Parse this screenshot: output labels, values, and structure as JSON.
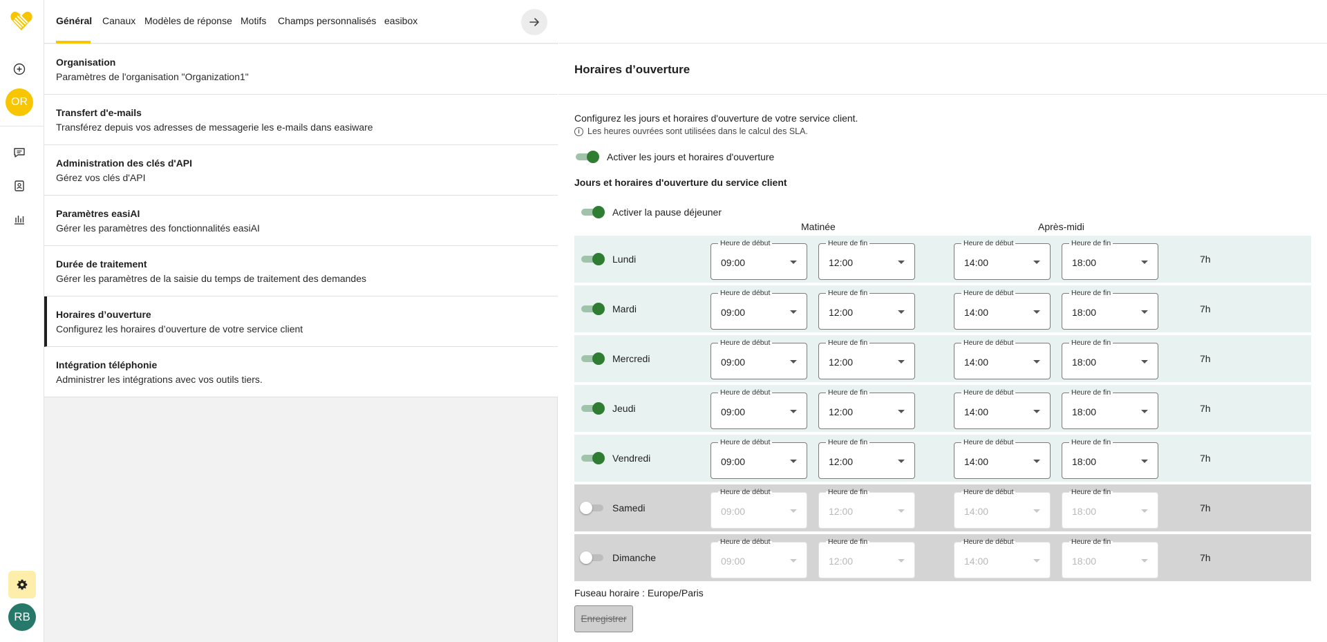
{
  "rail": {
    "logo_icon": "heart-logo-icon",
    "org_avatar": "OR",
    "user_avatar": "RB",
    "accent": "#f7c600"
  },
  "tabs": [
    {
      "label": "Général",
      "active": true
    },
    {
      "label": "Canaux",
      "active": false
    },
    {
      "label": "Modèles de réponse",
      "active": false
    },
    {
      "label": "Motifs",
      "active": false
    },
    {
      "label": "Champs personnalisés",
      "active": false
    },
    {
      "label": "easibox",
      "active": false
    }
  ],
  "settings": [
    {
      "title": "Organisation",
      "desc": "Paramètres de l'organisation \"Organization1\""
    },
    {
      "title": "Transfert d'e-mails",
      "desc": "Transférez depuis vos adresses de messagerie les e-mails dans easiware"
    },
    {
      "title": "Administration des clés d'API",
      "desc": "Gérez vos clés d'API"
    },
    {
      "title": "Paramètres easiAI",
      "desc": "Gérer les paramètres des fonctionnalités easiAI"
    },
    {
      "title": "Durée de traitement",
      "desc": "Gérer les paramètres de la saisie du temps de traitement des demandes"
    },
    {
      "title": "Horaires d’ouverture",
      "desc": "Configurez les horaires d’ouverture de votre service client",
      "selected": true
    },
    {
      "title": "Intégration téléphonie",
      "desc": "Administrer les intégrations avec vos outils tiers."
    }
  ],
  "main": {
    "title": "Horaires d’ouverture",
    "intro": "Configurez les jours et horaires d'ouverture de votre service client.",
    "note": "Les heures ouvrées sont utilisées dans le calcul des SLA.",
    "enable_hours_label": "Activer les jours et horaires d'ouverture",
    "section_title": "Jours et horaires d'ouverture du service client",
    "enable_lunch_label": "Activer la pause déjeuner",
    "col_morning": "Matinée",
    "col_afternoon": "Après-midi",
    "start_label": "Heure de début",
    "end_label": "Heure de fin",
    "timezone": "Fuseau horaire : Europe/Paris",
    "save_label": "Enregistrer",
    "days": [
      {
        "name": "Lundi",
        "enabled": true,
        "am_start": "09:00",
        "am_end": "12:00",
        "pm_start": "14:00",
        "pm_end": "18:00",
        "total": "7h"
      },
      {
        "name": "Mardi",
        "enabled": true,
        "am_start": "09:00",
        "am_end": "12:00",
        "pm_start": "14:00",
        "pm_end": "18:00",
        "total": "7h"
      },
      {
        "name": "Mercredi",
        "enabled": true,
        "am_start": "09:00",
        "am_end": "12:00",
        "pm_start": "14:00",
        "pm_end": "18:00",
        "total": "7h"
      },
      {
        "name": "Jeudi",
        "enabled": true,
        "am_start": "09:00",
        "am_end": "12:00",
        "pm_start": "14:00",
        "pm_end": "18:00",
        "total": "7h"
      },
      {
        "name": "Vendredi",
        "enabled": true,
        "am_start": "09:00",
        "am_end": "12:00",
        "pm_start": "14:00",
        "pm_end": "18:00",
        "total": "7h"
      },
      {
        "name": "Samedi",
        "enabled": false,
        "am_start": "09:00",
        "am_end": "12:00",
        "pm_start": "14:00",
        "pm_end": "18:00",
        "total": "7h"
      },
      {
        "name": "Dimanche",
        "enabled": false,
        "am_start": "09:00",
        "am_end": "12:00",
        "pm_start": "14:00",
        "pm_end": "18:00",
        "total": "7h"
      }
    ]
  }
}
